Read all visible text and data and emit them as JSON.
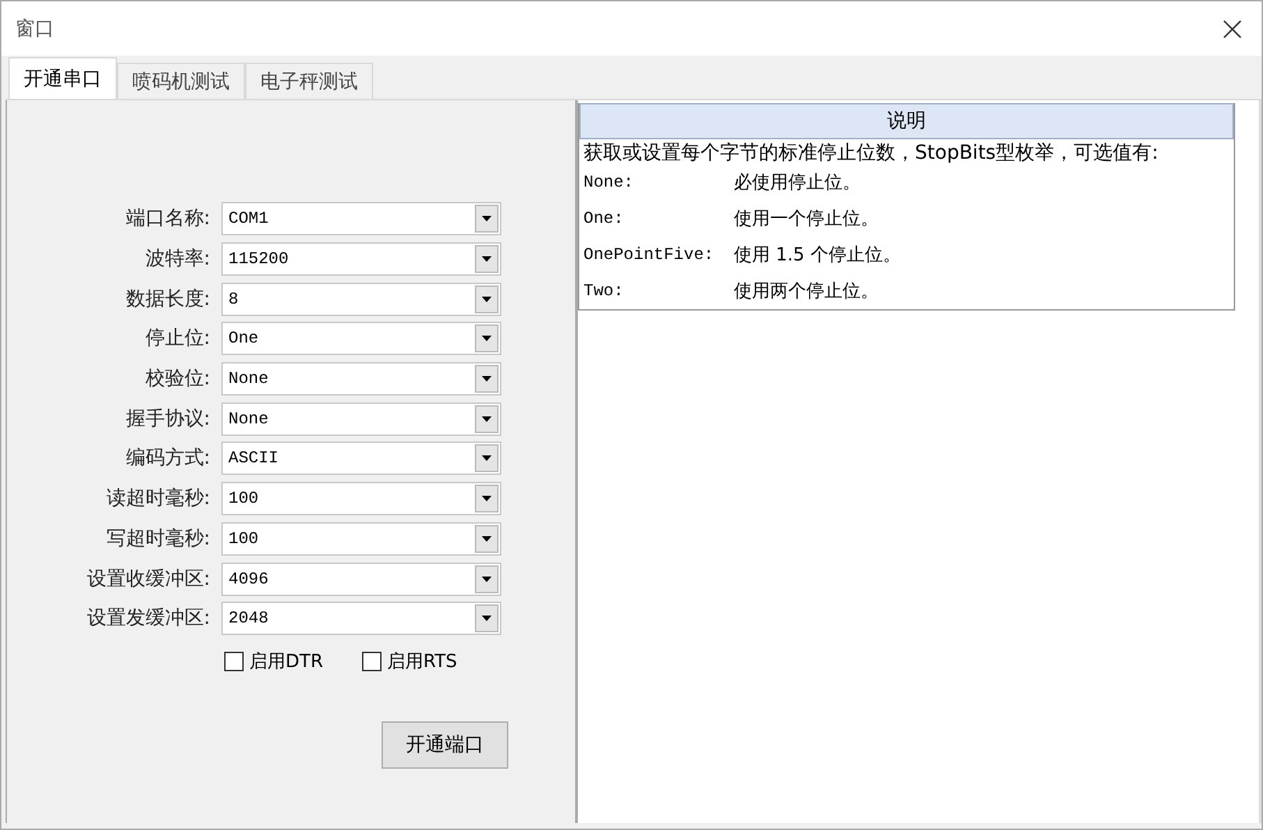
{
  "window": {
    "title": "窗口"
  },
  "tabs": [
    {
      "label": "开通串口",
      "selected": true
    },
    {
      "label": "喷码机测试",
      "selected": false
    },
    {
      "label": "电子秤测试",
      "selected": false
    }
  ],
  "form": {
    "fields": [
      {
        "label": "端口名称:",
        "value": "COM1"
      },
      {
        "label": "波特率:",
        "value": "115200"
      },
      {
        "label": "数据长度:",
        "value": "8"
      },
      {
        "label": "停止位:",
        "value": "One"
      },
      {
        "label": "校验位:",
        "value": "None"
      },
      {
        "label": "握手协议:",
        "value": "None"
      },
      {
        "label": "编码方式:",
        "value": "ASCII"
      },
      {
        "label": "读超时毫秒:",
        "value": "100"
      },
      {
        "label": "写超时毫秒:",
        "value": "100"
      },
      {
        "label": "设置收缓冲区:",
        "value": "4096"
      },
      {
        "label": "设置发缓冲区:",
        "value": "2048"
      }
    ],
    "options": [
      {
        "label": "启用DTR",
        "checked": false
      },
      {
        "label": "启用RTS",
        "checked": false
      }
    ],
    "button": "开通端口"
  },
  "help": {
    "header": "说明",
    "intro": "获取或设置每个字节的标准停止位数，StopBits型枚举，可选值有:",
    "entries": [
      {
        "name": "None:",
        "text": "必使用停止位。"
      },
      {
        "name": "One:",
        "text": "使用一个停止位。"
      },
      {
        "name": "OnePointFive:",
        "text": "使用 1.5 个停止位。"
      },
      {
        "name": "Two:",
        "text": "使用两个停止位。"
      }
    ]
  }
}
